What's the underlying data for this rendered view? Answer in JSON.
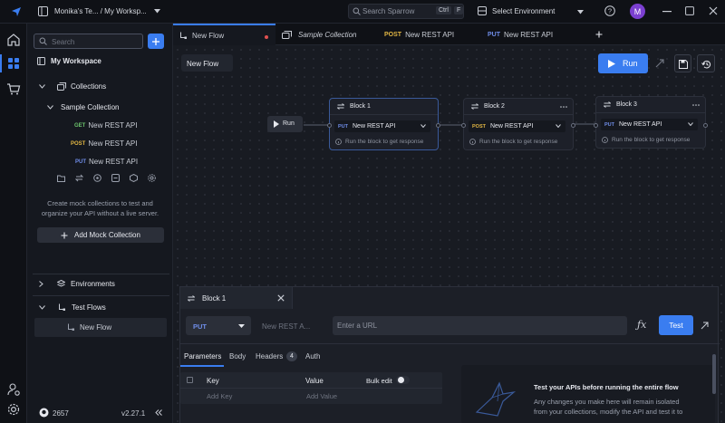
{
  "titlebar": {
    "workspace_path": "Monika's Te... / My Worksp...",
    "search_placeholder": "Search Sparrow",
    "shortcut_mod": "Ctrl",
    "shortcut_key": "F",
    "environment_label": "Select Environment",
    "avatar_initial": "M"
  },
  "sidebar": {
    "search_placeholder": "Search",
    "workspace_label": "My Workspace",
    "collections_label": "Collections",
    "collection_name": "Sample Collection",
    "requests": [
      {
        "method": "GET",
        "name": "New REST API"
      },
      {
        "method": "POST",
        "name": "New REST API"
      },
      {
        "method": "PUT",
        "name": "New REST API"
      }
    ],
    "mock_text_line1": "Create mock collections to test and",
    "mock_text_line2": "organize your API without a live server.",
    "mock_button_label": "Add Mock Collection",
    "environments_label": "Environments",
    "testflows_label": "Test Flows",
    "flow_item_label": "New Flow",
    "github_stars": "2657",
    "version": "v2.27.1"
  },
  "tabs": [
    {
      "label": "New Flow",
      "method": ""
    },
    {
      "label": "Sample Collection",
      "method": ""
    },
    {
      "label": "New REST API",
      "method": "POST"
    },
    {
      "label": "New REST API",
      "method": "PUT"
    }
  ],
  "canvas": {
    "flow_name": "New Flow",
    "run_label": "Run",
    "start_run_label": "Run",
    "blocks": [
      {
        "title": "Block 1",
        "method": "PUT",
        "request": "New REST API",
        "hint": "Run the block to get response"
      },
      {
        "title": "Block 2",
        "method": "POST",
        "request": "New REST API",
        "hint": "Run the block to get response"
      },
      {
        "title": "Block 3",
        "method": "PUT",
        "request": "New REST API",
        "hint": "Run the block to get response"
      }
    ]
  },
  "panel": {
    "title": "Block 1",
    "method": "PUT",
    "request_name": "New REST A...",
    "url_placeholder": "Enter a URL",
    "test_label": "Test",
    "tabs": [
      "Parameters",
      "Body",
      "Headers",
      "Auth"
    ],
    "headers_count": "4",
    "col_key": "Key",
    "col_value": "Value",
    "bulk_edit_label": "Bulk edit",
    "key_placeholder": "Add Key",
    "value_placeholder": "Add Value",
    "info_title": "Test your APIs before running the entire flow",
    "info_line1": "Any changes you make here will remain isolated",
    "info_line2": "from your collections, modify the API and test it to"
  },
  "colors": {
    "accent": "#3a7df0",
    "avatar": "#7b3fd0",
    "get": "#6cc36c",
    "post": "#e0b543",
    "put": "#6f8de8"
  }
}
